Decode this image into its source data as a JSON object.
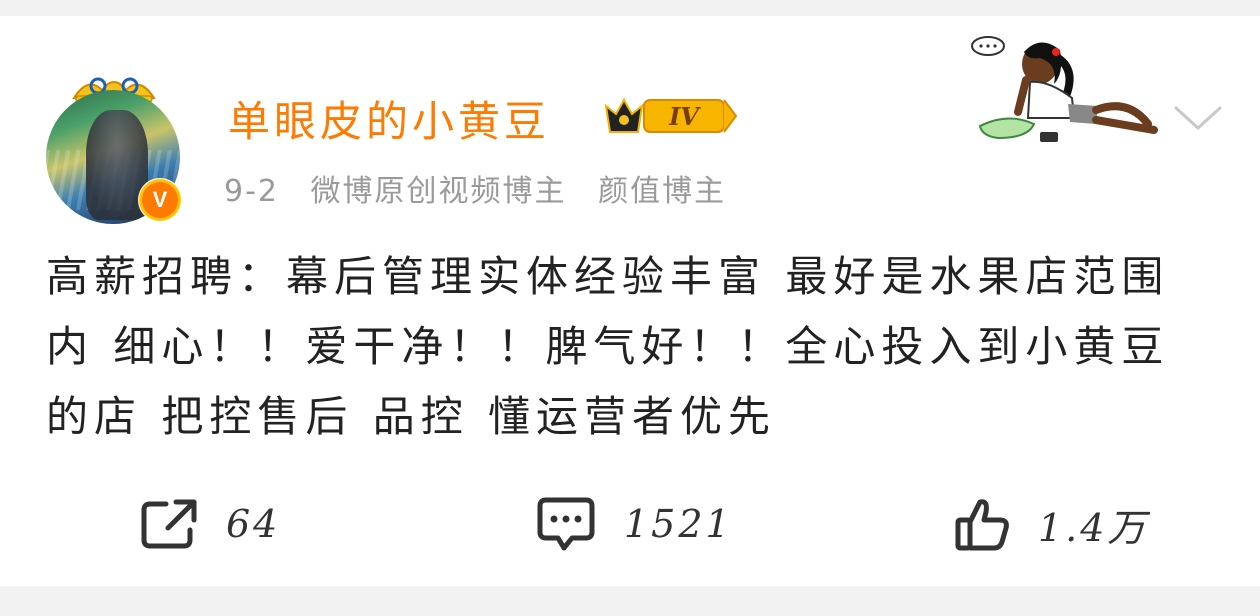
{
  "post": {
    "author": {
      "name": "单眼皮的小黄豆",
      "level_badge": "IV",
      "verified_badge": "V"
    },
    "meta": {
      "date": "9-2",
      "tag_1": "微博原创视频博主",
      "tag_2": "颜值博主"
    },
    "content": "高薪招聘：幕后管理实体经验丰富 最好是水果店范围内 细心！！爱干净！！脾气好！！全心投入到小黄豆的店 把控售后 品控 懂运营者优先",
    "actions": {
      "repost_count": "64",
      "comment_count": "1521",
      "like_count": "1.4万"
    },
    "icons": {
      "repost": "share-icon",
      "comment": "comment-icon",
      "like": "thumbs-up-icon",
      "menu": "chevron-down-icon"
    }
  },
  "colors": {
    "username": "#ff7a00",
    "meta": "#9a9a9a",
    "text": "#222222",
    "background": "#f2f2f2",
    "card": "#ffffff"
  }
}
